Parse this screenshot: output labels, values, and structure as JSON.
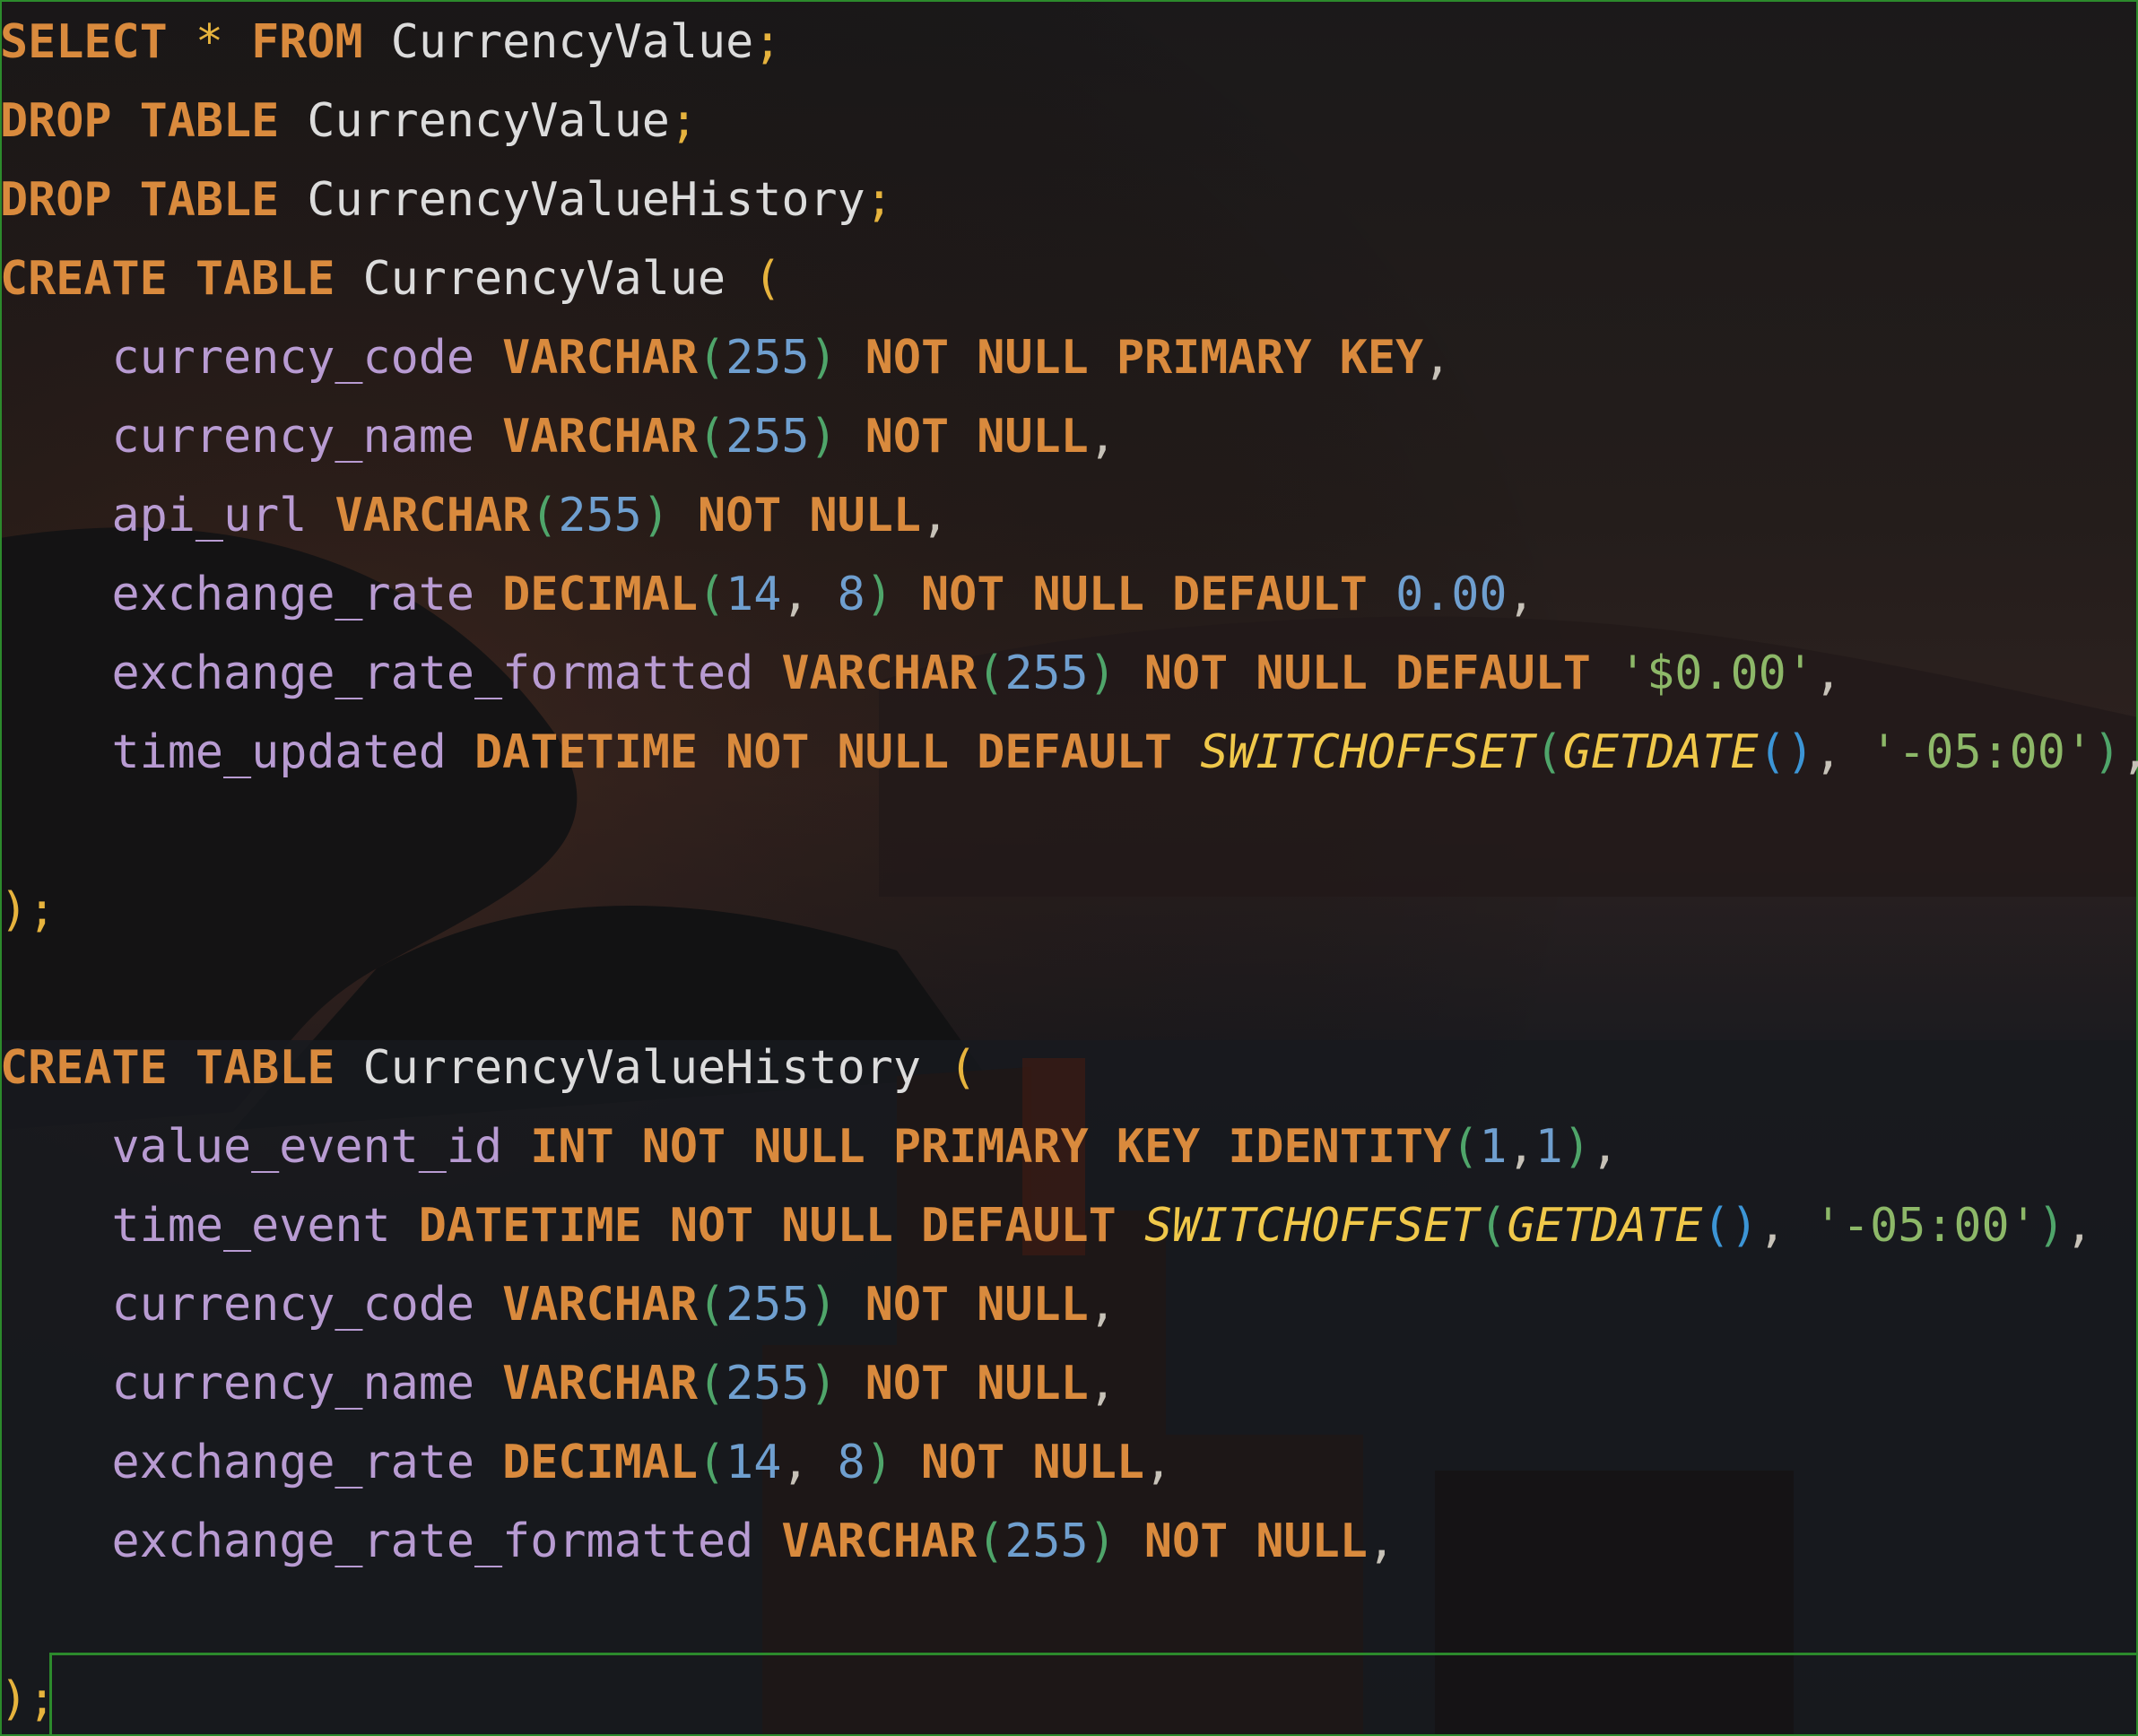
{
  "colors": {
    "keyword": "#d98a3d",
    "identifier": "#dcdcdc",
    "column": "#b89bd2",
    "number": "#6f9fcf",
    "string": "#8db868",
    "function": "#f0c84a",
    "frame_border": "#2c8a2c"
  },
  "lines": [
    [
      [
        "kw",
        "SELECT"
      ],
      [
        "punc",
        " "
      ],
      [
        "op",
        "*"
      ],
      [
        "punc",
        " "
      ],
      [
        "kw",
        "FROM"
      ],
      [
        "punc",
        " "
      ],
      [
        "id",
        "CurrencyValue"
      ],
      [
        "op",
        ";"
      ]
    ],
    [
      [
        "kw",
        "DROP"
      ],
      [
        "punc",
        " "
      ],
      [
        "kw",
        "TABLE"
      ],
      [
        "punc",
        " "
      ],
      [
        "id",
        "CurrencyValue"
      ],
      [
        "op",
        ";"
      ]
    ],
    [
      [
        "kw",
        "DROP"
      ],
      [
        "punc",
        " "
      ],
      [
        "kw",
        "TABLE"
      ],
      [
        "punc",
        " "
      ],
      [
        "id",
        "CurrencyValueHistory"
      ],
      [
        "op",
        ";"
      ]
    ],
    [
      [
        "kw",
        "CREATE"
      ],
      [
        "punc",
        " "
      ],
      [
        "kw",
        "TABLE"
      ],
      [
        "punc",
        " "
      ],
      [
        "id",
        "CurrencyValue"
      ],
      [
        "punc",
        " "
      ],
      [
        "p1",
        "("
      ]
    ],
    [
      [
        "punc",
        "    "
      ],
      [
        "col",
        "currency_code"
      ],
      [
        "punc",
        " "
      ],
      [
        "kw",
        "VARCHAR"
      ],
      [
        "p2",
        "("
      ],
      [
        "num",
        "255"
      ],
      [
        "p2",
        ")"
      ],
      [
        "punc",
        " "
      ],
      [
        "kw",
        "NOT"
      ],
      [
        "punc",
        " "
      ],
      [
        "kw",
        "NULL"
      ],
      [
        "punc",
        " "
      ],
      [
        "kw",
        "PRIMARY"
      ],
      [
        "punc",
        " "
      ],
      [
        "kw",
        "KEY"
      ],
      [
        "punc",
        ","
      ]
    ],
    [
      [
        "punc",
        "    "
      ],
      [
        "col",
        "currency_name"
      ],
      [
        "punc",
        " "
      ],
      [
        "kw",
        "VARCHAR"
      ],
      [
        "p2",
        "("
      ],
      [
        "num",
        "255"
      ],
      [
        "p2",
        ")"
      ],
      [
        "punc",
        " "
      ],
      [
        "kw",
        "NOT"
      ],
      [
        "punc",
        " "
      ],
      [
        "kw",
        "NULL"
      ],
      [
        "punc",
        ","
      ]
    ],
    [
      [
        "punc",
        "    "
      ],
      [
        "col",
        "api_url"
      ],
      [
        "punc",
        " "
      ],
      [
        "kw",
        "VARCHAR"
      ],
      [
        "p2",
        "("
      ],
      [
        "num",
        "255"
      ],
      [
        "p2",
        ")"
      ],
      [
        "punc",
        " "
      ],
      [
        "kw",
        "NOT"
      ],
      [
        "punc",
        " "
      ],
      [
        "kw",
        "NULL"
      ],
      [
        "punc",
        ","
      ]
    ],
    [
      [
        "punc",
        "    "
      ],
      [
        "col",
        "exchange_rate"
      ],
      [
        "punc",
        " "
      ],
      [
        "kw",
        "DECIMAL"
      ],
      [
        "p2",
        "("
      ],
      [
        "num",
        "14"
      ],
      [
        "punc",
        ", "
      ],
      [
        "num",
        "8"
      ],
      [
        "p2",
        ")"
      ],
      [
        "punc",
        " "
      ],
      [
        "kw",
        "NOT"
      ],
      [
        "punc",
        " "
      ],
      [
        "kw",
        "NULL"
      ],
      [
        "punc",
        " "
      ],
      [
        "kw",
        "DEFAULT"
      ],
      [
        "punc",
        " "
      ],
      [
        "num",
        "0.00"
      ],
      [
        "punc",
        ","
      ]
    ],
    [
      [
        "punc",
        "    "
      ],
      [
        "col",
        "exchange_rate_formatted"
      ],
      [
        "punc",
        " "
      ],
      [
        "kw",
        "VARCHAR"
      ],
      [
        "p2",
        "("
      ],
      [
        "num",
        "255"
      ],
      [
        "p2",
        ")"
      ],
      [
        "punc",
        " "
      ],
      [
        "kw",
        "NOT"
      ],
      [
        "punc",
        " "
      ],
      [
        "kw",
        "NULL"
      ],
      [
        "punc",
        " "
      ],
      [
        "kw",
        "DEFAULT"
      ],
      [
        "punc",
        " "
      ],
      [
        "str",
        "'$0.00'"
      ],
      [
        "punc",
        ","
      ]
    ],
    [
      [
        "punc",
        "    "
      ],
      [
        "col",
        "time_updated"
      ],
      [
        "punc",
        " "
      ],
      [
        "kw",
        "DATETIME"
      ],
      [
        "punc",
        " "
      ],
      [
        "kw",
        "NOT"
      ],
      [
        "punc",
        " "
      ],
      [
        "kw",
        "NULL"
      ],
      [
        "punc",
        " "
      ],
      [
        "kw",
        "DEFAULT"
      ],
      [
        "punc",
        " "
      ],
      [
        "fn",
        "SWITCHOFFSET"
      ],
      [
        "p2",
        "("
      ],
      [
        "fn",
        "GETDATE"
      ],
      [
        "p3",
        "()"
      ],
      [
        "punc",
        ", "
      ],
      [
        "str",
        "'-05:00'"
      ],
      [
        "p2",
        ")"
      ],
      [
        "punc",
        ","
      ]
    ],
    [],
    [
      [
        "p1",
        ")"
      ],
      [
        "op",
        ";"
      ]
    ],
    [],
    [
      [
        "kw",
        "CREATE"
      ],
      [
        "punc",
        " "
      ],
      [
        "kw",
        "TABLE"
      ],
      [
        "punc",
        " "
      ],
      [
        "id",
        "CurrencyValueHistory"
      ],
      [
        "punc",
        " "
      ],
      [
        "p1",
        "("
      ]
    ],
    [
      [
        "punc",
        "    "
      ],
      [
        "col",
        "value_event_id"
      ],
      [
        "punc",
        " "
      ],
      [
        "kw",
        "INT"
      ],
      [
        "punc",
        " "
      ],
      [
        "kw",
        "NOT"
      ],
      [
        "punc",
        " "
      ],
      [
        "kw",
        "NULL"
      ],
      [
        "punc",
        " "
      ],
      [
        "kw",
        "PRIMARY"
      ],
      [
        "punc",
        " "
      ],
      [
        "kw",
        "KEY"
      ],
      [
        "punc",
        " "
      ],
      [
        "kw",
        "IDENTITY"
      ],
      [
        "p2",
        "("
      ],
      [
        "num",
        "1"
      ],
      [
        "punc",
        ","
      ],
      [
        "num",
        "1"
      ],
      [
        "p2",
        ")"
      ],
      [
        "punc",
        ","
      ]
    ],
    [
      [
        "punc",
        "    "
      ],
      [
        "col",
        "time_event"
      ],
      [
        "punc",
        " "
      ],
      [
        "kw",
        "DATETIME"
      ],
      [
        "punc",
        " "
      ],
      [
        "kw",
        "NOT"
      ],
      [
        "punc",
        " "
      ],
      [
        "kw",
        "NULL"
      ],
      [
        "punc",
        " "
      ],
      [
        "kw",
        "DEFAULT"
      ],
      [
        "punc",
        " "
      ],
      [
        "fn",
        "SWITCHOFFSET"
      ],
      [
        "p2",
        "("
      ],
      [
        "fn",
        "GETDATE"
      ],
      [
        "p3",
        "()"
      ],
      [
        "punc",
        ", "
      ],
      [
        "str",
        "'-05:00'"
      ],
      [
        "p2",
        ")"
      ],
      [
        "punc",
        ","
      ]
    ],
    [
      [
        "punc",
        "    "
      ],
      [
        "col",
        "currency_code"
      ],
      [
        "punc",
        " "
      ],
      [
        "kw",
        "VARCHAR"
      ],
      [
        "p2",
        "("
      ],
      [
        "num",
        "255"
      ],
      [
        "p2",
        ")"
      ],
      [
        "punc",
        " "
      ],
      [
        "kw",
        "NOT"
      ],
      [
        "punc",
        " "
      ],
      [
        "kw",
        "NULL"
      ],
      [
        "punc",
        ","
      ]
    ],
    [
      [
        "punc",
        "    "
      ],
      [
        "col",
        "currency_name"
      ],
      [
        "punc",
        " "
      ],
      [
        "kw",
        "VARCHAR"
      ],
      [
        "p2",
        "("
      ],
      [
        "num",
        "255"
      ],
      [
        "p2",
        ")"
      ],
      [
        "punc",
        " "
      ],
      [
        "kw",
        "NOT"
      ],
      [
        "punc",
        " "
      ],
      [
        "kw",
        "NULL"
      ],
      [
        "punc",
        ","
      ]
    ],
    [
      [
        "punc",
        "    "
      ],
      [
        "col",
        "exchange_rate"
      ],
      [
        "punc",
        " "
      ],
      [
        "kw",
        "DECIMAL"
      ],
      [
        "p2",
        "("
      ],
      [
        "num",
        "14"
      ],
      [
        "punc",
        ", "
      ],
      [
        "num",
        "8"
      ],
      [
        "p2",
        ")"
      ],
      [
        "punc",
        " "
      ],
      [
        "kw",
        "NOT"
      ],
      [
        "punc",
        " "
      ],
      [
        "kw",
        "NULL"
      ],
      [
        "punc",
        ","
      ]
    ],
    [
      [
        "punc",
        "    "
      ],
      [
        "col",
        "exchange_rate_formatted"
      ],
      [
        "punc",
        " "
      ],
      [
        "kw",
        "VARCHAR"
      ],
      [
        "p2",
        "("
      ],
      [
        "num",
        "255"
      ],
      [
        "p2",
        ")"
      ],
      [
        "punc",
        " "
      ],
      [
        "kw",
        "NOT"
      ],
      [
        "punc",
        " "
      ],
      [
        "kw",
        "NULL"
      ],
      [
        "punc",
        ","
      ]
    ],
    [],
    [
      [
        "p1",
        ")"
      ],
      [
        "op",
        ";"
      ]
    ]
  ]
}
